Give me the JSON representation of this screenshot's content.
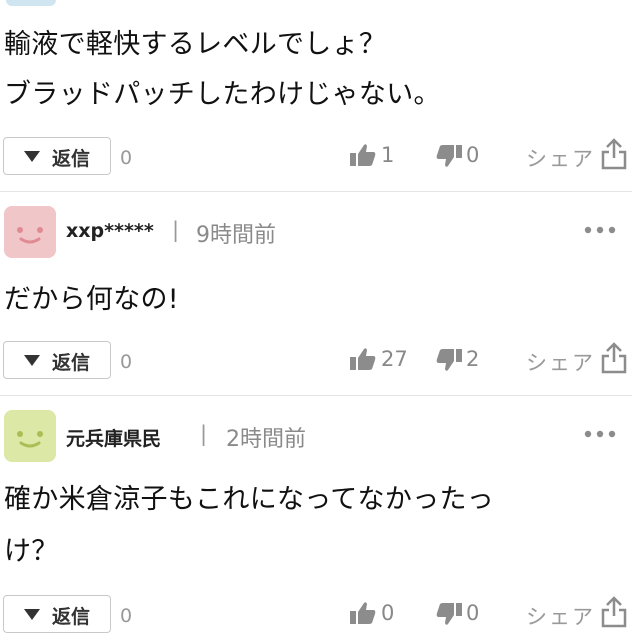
{
  "comments": [
    {
      "body_lines": [
        "輸液で軽快するレベルでしょ？",
        "ブラッドパッチしたわけじゃない。"
      ],
      "reply_label": "返信",
      "reply_count": "0",
      "likes": "1",
      "dislikes": "0",
      "share_label": "シェア"
    },
    {
      "username": "xxp*****",
      "separator": "|",
      "time": "9時間前",
      "avatar_color": "#f0c6c8",
      "avatar_face_color": "#e08b93",
      "body_lines": [
        "だから何なの!"
      ],
      "reply_label": "返信",
      "reply_count": "0",
      "likes": "27",
      "dislikes": "2",
      "share_label": "シェア"
    },
    {
      "username": "元兵庫県民",
      "separator": "|",
      "time": "2時間前",
      "avatar_color": "#dbe8a6",
      "avatar_face_color": "#a9bf55",
      "body_lines": [
        "確か米倉涼子もこれになってなかったっ",
        "け？"
      ],
      "reply_label": "返信",
      "reply_count": "0",
      "likes": "0",
      "dislikes": "0",
      "share_label": "シェア"
    }
  ],
  "icons": {
    "reply_toggle": "triangle-down-icon",
    "like": "thumbs-up-icon",
    "dislike": "thumbs-down-icon",
    "share": "share-icon",
    "more": "more-dots-icon"
  },
  "colors": {
    "icon_gray": "#8c8c8c",
    "muted_text": "#999999",
    "divider": "#e4e4e4"
  }
}
